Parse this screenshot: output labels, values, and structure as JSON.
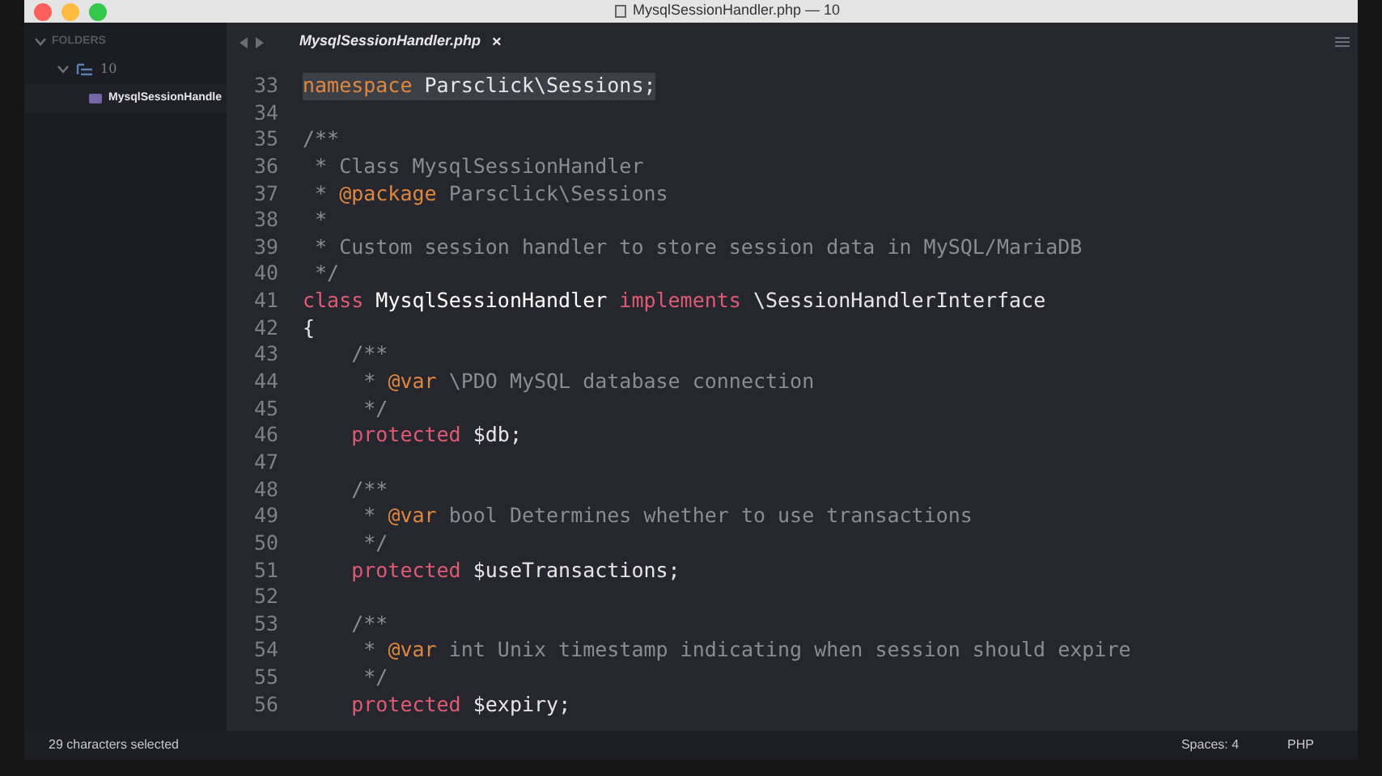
{
  "window": {
    "title": "MysqlSessionHandler.php — 10"
  },
  "sidebar": {
    "header": "FOLDERS",
    "items": [
      {
        "kind": "folder",
        "label": "10",
        "expanded": true,
        "children": [
          {
            "kind": "file",
            "label": "MysqlSessionHandle",
            "selected": true
          }
        ]
      }
    ]
  },
  "tabs": [
    {
      "label": "MysqlSessionHandler.php",
      "close": "×",
      "selected": true
    }
  ],
  "editor": {
    "lines": [
      {
        "number": "33",
        "selected": true,
        "tokens": [
          {
            "kind": "keyword",
            "text": "namespace"
          },
          {
            "kind": "plain",
            "text": " Parsclick\\Sessions;"
          }
        ]
      },
      {
        "number": "34",
        "selected": false
      },
      {
        "number": "35",
        "selected": false,
        "tokens": [
          {
            "kind": "comment",
            "text": "/**"
          }
        ]
      },
      {
        "number": "36",
        "selected": false,
        "tokens": [
          {
            "kind": "comment",
            "text": " * Class MysqlSessionHandler"
          }
        ]
      },
      {
        "number": "37",
        "selected": false,
        "tokens": [
          {
            "kind": "comment",
            "text": " * "
          },
          {
            "kind": "doctag",
            "text": "@package"
          },
          {
            "kind": "comment",
            "text": " Parsclick\\Sessions"
          }
        ]
      },
      {
        "number": "38",
        "selected": false,
        "tokens": [
          {
            "kind": "comment",
            "text": " *"
          }
        ]
      },
      {
        "number": "39",
        "selected": false,
        "tokens": [
          {
            "kind": "comment",
            "text": " * Custom session handler to store session data in MySQL/MariaDB"
          }
        ]
      },
      {
        "number": "40",
        "selected": false,
        "tokens": [
          {
            "kind": "comment",
            "text": " */"
          }
        ]
      },
      {
        "number": "41",
        "selected": false,
        "tokens": [
          {
            "kind": "storage",
            "text": "class"
          },
          {
            "kind": "name",
            "text": " MysqlSessionHandler"
          },
          {
            "kind": "storage",
            "text": " implements"
          },
          {
            "kind": "plain",
            "text": " \\SessionHandlerInterface"
          }
        ]
      },
      {
        "number": "42",
        "selected": false,
        "tokens": [
          {
            "kind": "plain",
            "text": "{"
          }
        ]
      },
      {
        "number": "43",
        "selected": false,
        "tokens": [
          {
            "kind": "comment",
            "text": "    /**"
          }
        ]
      },
      {
        "number": "44",
        "selected": false,
        "tokens": [
          {
            "kind": "comment",
            "text": "     * "
          },
          {
            "kind": "doctag",
            "text": "@var"
          },
          {
            "kind": "comment",
            "text": " \\PDO MySQL database connection"
          }
        ]
      },
      {
        "number": "45",
        "selected": false,
        "tokens": [
          {
            "kind": "comment",
            "text": "     */"
          }
        ]
      },
      {
        "number": "46",
        "selected": false,
        "tokens": [
          {
            "kind": "storage",
            "text": "    protected"
          },
          {
            "kind": "variable",
            "text": " $db"
          },
          {
            "kind": "plain",
            "text": ";"
          }
        ]
      },
      {
        "number": "47",
        "selected": false
      },
      {
        "number": "48",
        "selected": false,
        "tokens": [
          {
            "kind": "comment",
            "text": "    /**"
          }
        ]
      },
      {
        "number": "49",
        "selected": false,
        "tokens": [
          {
            "kind": "comment",
            "text": "     * "
          },
          {
            "kind": "doctag",
            "text": "@var"
          },
          {
            "kind": "comment",
            "text": " bool Determines whether to use transactions"
          }
        ]
      },
      {
        "number": "50",
        "selected": false,
        "tokens": [
          {
            "kind": "comment",
            "text": "     */"
          }
        ]
      },
      {
        "number": "51",
        "selected": false,
        "tokens": [
          {
            "kind": "storage",
            "text": "    protected"
          },
          {
            "kind": "variable",
            "text": " $useTransactions"
          },
          {
            "kind": "plain",
            "text": ";"
          }
        ]
      },
      {
        "number": "52",
        "selected": false
      },
      {
        "number": "53",
        "selected": false,
        "tokens": [
          {
            "kind": "comment",
            "text": "    /**"
          }
        ]
      },
      {
        "number": "54",
        "selected": false,
        "tokens": [
          {
            "kind": "comment",
            "text": "     * "
          },
          {
            "kind": "doctag",
            "text": "@var"
          },
          {
            "kind": "comment",
            "text": " int Unix timestamp indicating when session should expire"
          }
        ]
      },
      {
        "number": "55",
        "selected": false,
        "tokens": [
          {
            "kind": "comment",
            "text": "     */"
          }
        ]
      },
      {
        "number": "56",
        "selected": false,
        "tokens": [
          {
            "kind": "storage",
            "text": "    protected"
          },
          {
            "kind": "variable",
            "text": " $expiry"
          },
          {
            "kind": "plain",
            "text": ";"
          }
        ]
      }
    ]
  },
  "status_bar": {
    "selection": "29 characters selected",
    "indentation": "Spaces: 4",
    "syntax": "PHP"
  }
}
